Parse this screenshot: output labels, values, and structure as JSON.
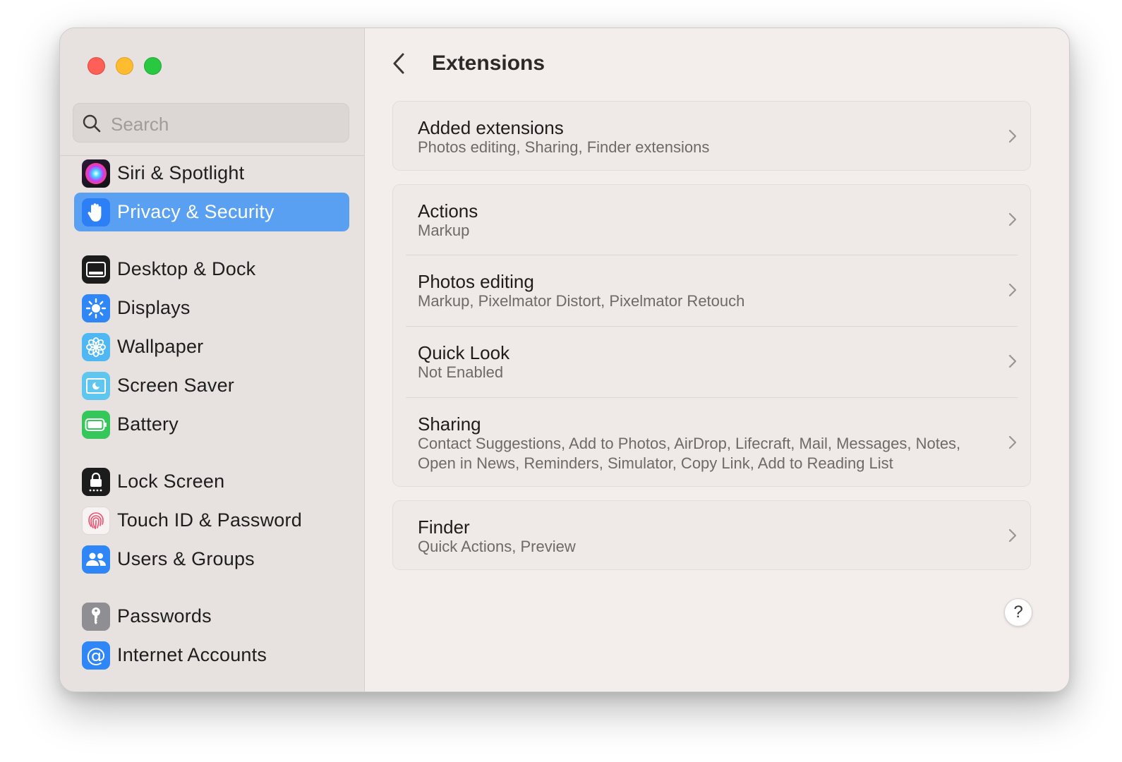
{
  "window": {
    "title": "Extensions"
  },
  "search": {
    "placeholder": "Search"
  },
  "sidebar": {
    "items": [
      {
        "label": "Siri & Spotlight",
        "icon": "siri-icon"
      },
      {
        "label": "Privacy & Security",
        "icon": "hand-icon",
        "selected": true
      },
      {
        "label": "Desktop & Dock",
        "icon": "dock-icon"
      },
      {
        "label": "Displays",
        "icon": "sun-icon"
      },
      {
        "label": "Wallpaper",
        "icon": "flower-icon"
      },
      {
        "label": "Screen Saver",
        "icon": "screen-saver-icon"
      },
      {
        "label": "Battery",
        "icon": "battery-icon"
      },
      {
        "label": "Lock Screen",
        "icon": "lock-icon"
      },
      {
        "label": "Touch ID & Password",
        "icon": "fingerprint-icon"
      },
      {
        "label": "Users & Groups",
        "icon": "users-icon"
      },
      {
        "label": "Passwords",
        "icon": "key-icon"
      },
      {
        "label": "Internet Accounts",
        "icon": "at-icon"
      }
    ]
  },
  "sections": {
    "added": {
      "title": "Added extensions",
      "subtitle": "Photos editing, Sharing, Finder extensions"
    },
    "actions": {
      "title": "Actions",
      "subtitle": "Markup"
    },
    "photos": {
      "title": "Photos editing",
      "subtitle": "Markup, Pixelmator Distort, Pixelmator Retouch"
    },
    "quicklook": {
      "title": "Quick Look",
      "subtitle": "Not Enabled"
    },
    "sharing": {
      "title": "Sharing",
      "subtitle_line1": "Contact Suggestions, Add to Photos, AirDrop, Lifecraft, Mail, Messages, Notes,",
      "subtitle_line2": "Open in News, Reminders, Simulator, Copy Link, Add to Reading List"
    },
    "finder": {
      "title": "Finder",
      "subtitle": "Quick Actions, Preview"
    }
  },
  "help": {
    "label": "?"
  },
  "colors": {
    "accent": "#5aa0f2",
    "close": "#fe5f57",
    "minimize": "#febc2e",
    "zoom": "#28c840"
  }
}
